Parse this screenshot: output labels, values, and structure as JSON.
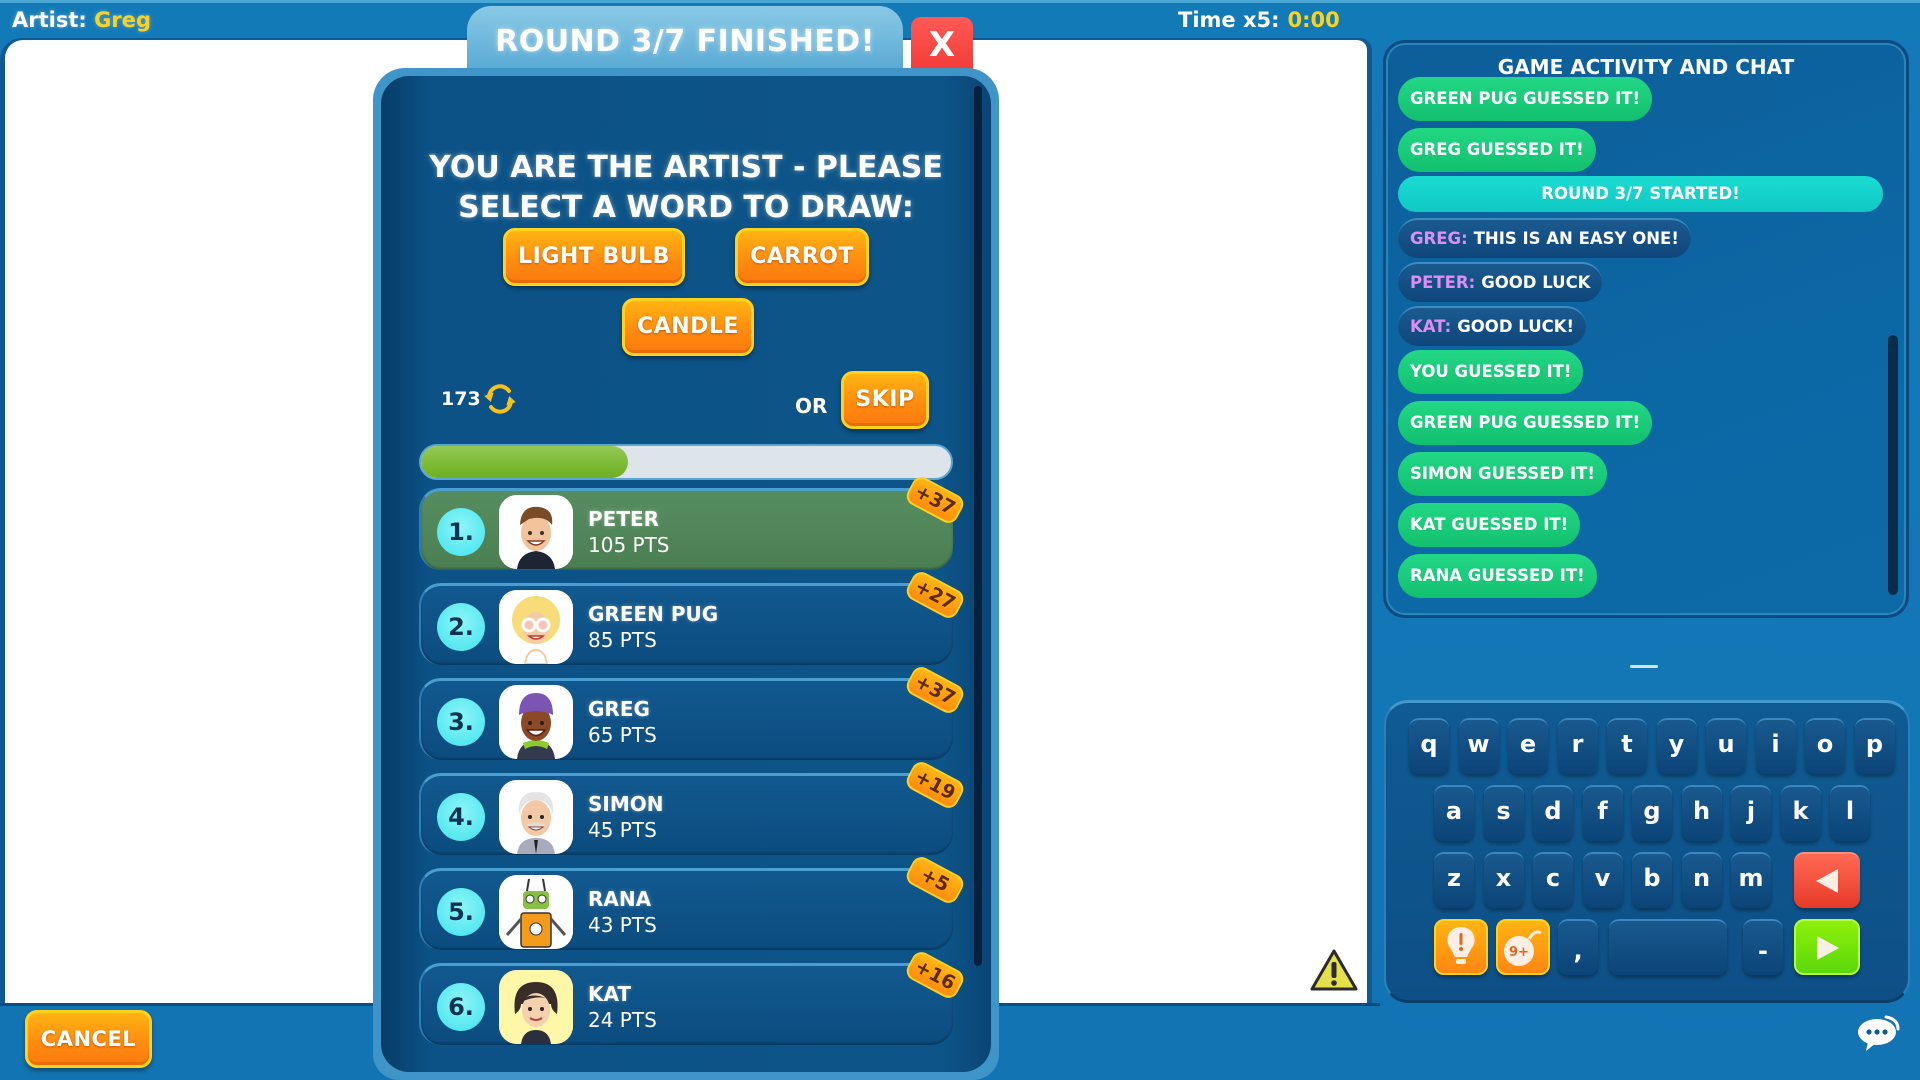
{
  "header": {
    "artist_label": "Artist:",
    "artist_name": "Greg",
    "time_label": "Time x5:",
    "time_value": "0:00"
  },
  "colors": {
    "accent_yellow": "#ffd21a",
    "button_orange": "#ff8a10",
    "guess_green": "#12c06f",
    "system_teal": "#0fc8c4",
    "author_purple": "#e08cf5",
    "leader_green": "#4b7f52",
    "progress_green": "#6cb020",
    "close_red": "#f23a37"
  },
  "modal": {
    "title": "ROUND 3/7 FINISHED!",
    "close_label": "X",
    "prompt_line1": "YOU ARE THE ARTIST - PLEASE",
    "prompt_line2": "SELECT A WORD TO DRAW:",
    "words": [
      "LIGHT BULB",
      "CARROT",
      "CANDLE"
    ],
    "reroll_count": "173",
    "reroll_icon": "refresh-icon",
    "or_label": "OR",
    "skip_label": "SKIP",
    "progress_percent": 39
  },
  "leaderboard": [
    {
      "rank": "1.",
      "name": "PETER",
      "points": "105 PTS",
      "gain": "+37",
      "avatar": "peter-avatar",
      "highlight": true
    },
    {
      "rank": "2.",
      "name": "GREEN PUG",
      "points": "85 PTS",
      "gain": "+27",
      "avatar": "green-pug-avatar",
      "highlight": false
    },
    {
      "rank": "3.",
      "name": "GREG",
      "points": "65 PTS",
      "gain": "+37",
      "avatar": "greg-avatar",
      "highlight": false
    },
    {
      "rank": "4.",
      "name": "SIMON",
      "points": "45 PTS",
      "gain": "+19",
      "avatar": "simon-avatar",
      "highlight": false
    },
    {
      "rank": "5.",
      "name": "RANA",
      "points": "43 PTS",
      "gain": "+5",
      "avatar": "rana-avatar",
      "highlight": false
    },
    {
      "rank": "6.",
      "name": "KAT",
      "points": "24 PTS",
      "gain": "+16",
      "avatar": "kat-avatar",
      "highlight": false
    }
  ],
  "chat": {
    "title": "GAME ACTIVITY AND CHAT",
    "messages": [
      {
        "type": "guess",
        "text": "GREEN PUG GUESSED IT!"
      },
      {
        "type": "guess",
        "text": "GREG GUESSED IT!"
      },
      {
        "type": "system",
        "text": "ROUND 3/7 STARTED!"
      },
      {
        "type": "user",
        "author": "GREG:",
        "text": "THIS IS AN EASY ONE!"
      },
      {
        "type": "user",
        "author": "PETER:",
        "text": "GOOD LUCK"
      },
      {
        "type": "user",
        "author": "KAT:",
        "text": "GOOD LUCK!"
      },
      {
        "type": "guess",
        "text": "YOU GUESSED IT!"
      },
      {
        "type": "guess",
        "text": "GREEN PUG GUESSED IT!"
      },
      {
        "type": "guess",
        "text": "SIMON GUESSED IT!"
      },
      {
        "type": "guess",
        "text": "KAT GUESSED IT!"
      },
      {
        "type": "guess",
        "text": "RANA GUESSED IT!"
      }
    ]
  },
  "keyboard": {
    "row1": [
      "q",
      "w",
      "e",
      "r",
      "t",
      "y",
      "u",
      "i",
      "o",
      "p"
    ],
    "row2": [
      "a",
      "s",
      "d",
      "f",
      "g",
      "h",
      "j",
      "k",
      "l"
    ],
    "row3": [
      "z",
      "x",
      "c",
      "v",
      "b",
      "n",
      "m"
    ],
    "hint_icon": "lightbulb-hint-icon",
    "bomb_label": "9+",
    "comma_key": ",",
    "dash_key": "-",
    "more_dots": "•••",
    "backspace_icon": "backspace-arrow-icon",
    "enter_icon": "send-arrow-icon"
  },
  "footer": {
    "cancel_label": "CANCEL",
    "warning_icon": "warning-icon",
    "chat_toggle_icon": "chat-bubble-icon"
  }
}
